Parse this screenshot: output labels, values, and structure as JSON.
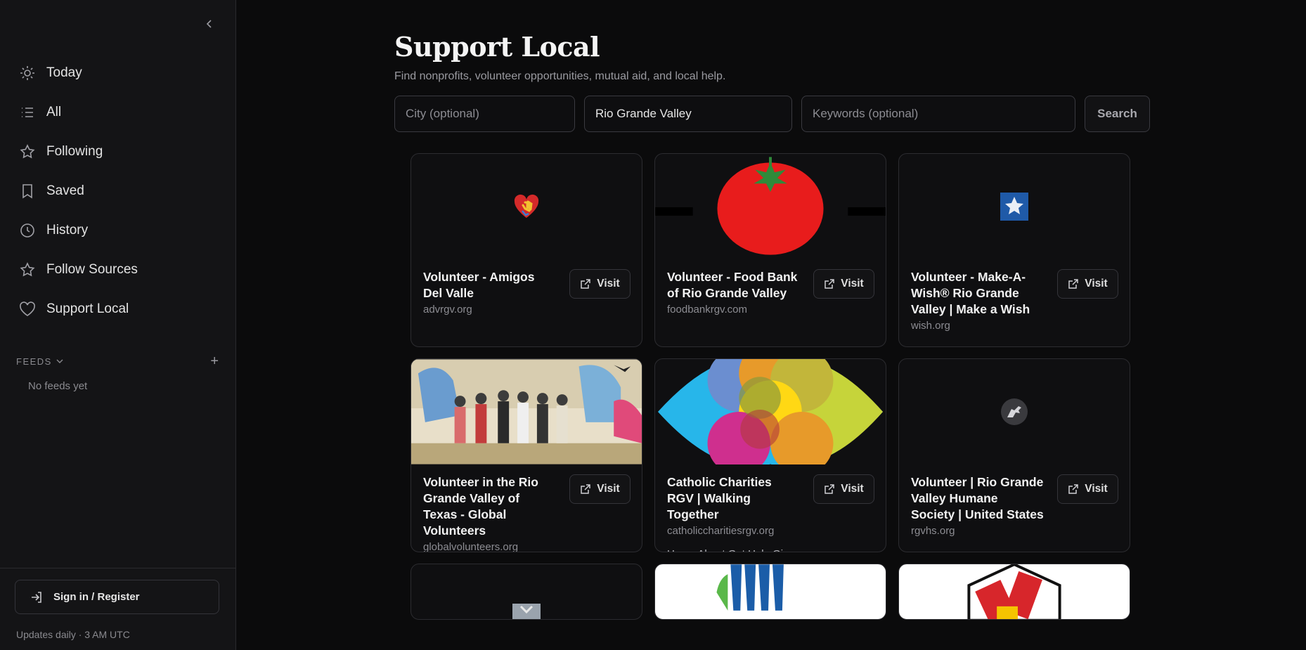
{
  "sidebar": {
    "nav": [
      {
        "label": "Today",
        "icon": "sun-icon"
      },
      {
        "label": "All",
        "icon": "list-icon"
      },
      {
        "label": "Following",
        "icon": "star-icon"
      },
      {
        "label": "Saved",
        "icon": "bookmark-icon"
      },
      {
        "label": "History",
        "icon": "clock-icon"
      },
      {
        "label": "Follow Sources",
        "icon": "star-icon"
      },
      {
        "label": "Support Local",
        "icon": "heart-icon"
      }
    ],
    "feeds_title": "FEEDS",
    "no_feeds": "No feeds yet",
    "signin_label": "Sign in / Register",
    "updates": "Updates daily · 3 AM UTC"
  },
  "main": {
    "title": "Support Local",
    "subtitle": "Find nonprofits, volunteer opportunities, mutual aid, and local help.",
    "search": {
      "city_placeholder": "City (optional)",
      "region_value": "Rio Grande Valley",
      "keywords_placeholder": "Keywords (optional)",
      "button": "Search"
    },
    "visit_label": "Visit",
    "cards": [
      {
        "title": "Volunteer - Amigos Del Valle",
        "domain": "advrgv.org",
        "image": "heart-hand-logo"
      },
      {
        "title": "Volunteer - Food Bank of Rio Grande Valley",
        "domain": "foodbankrgv.com",
        "image": "tomato-logo"
      },
      {
        "title": "Volunteer - Make-A-Wish® Rio Grande Valley | Make a Wish",
        "domain": "wish.org",
        "image": "star-logo"
      },
      {
        "title": "Volunteer in the Rio Grande Valley of Texas - Global Volunteers",
        "domain": "globalvolunteers.org",
        "image": "group-photo"
      },
      {
        "title": "Catholic Charities RGV | Walking Together",
        "domain": "catholiccharitiesrgv.org",
        "description": "Home About Get Help Give Help Gallery Events Follo...",
        "image": "colorful-circles-logo"
      },
      {
        "title": "Volunteer | Rio Grande Valley Humane Society | United States",
        "domain": "rgvhs.org",
        "image": "dog-logo"
      }
    ]
  },
  "colors": {
    "background": "#0b0b0c",
    "sidebar": "#141416",
    "tomato": "#e81c1c"
  }
}
